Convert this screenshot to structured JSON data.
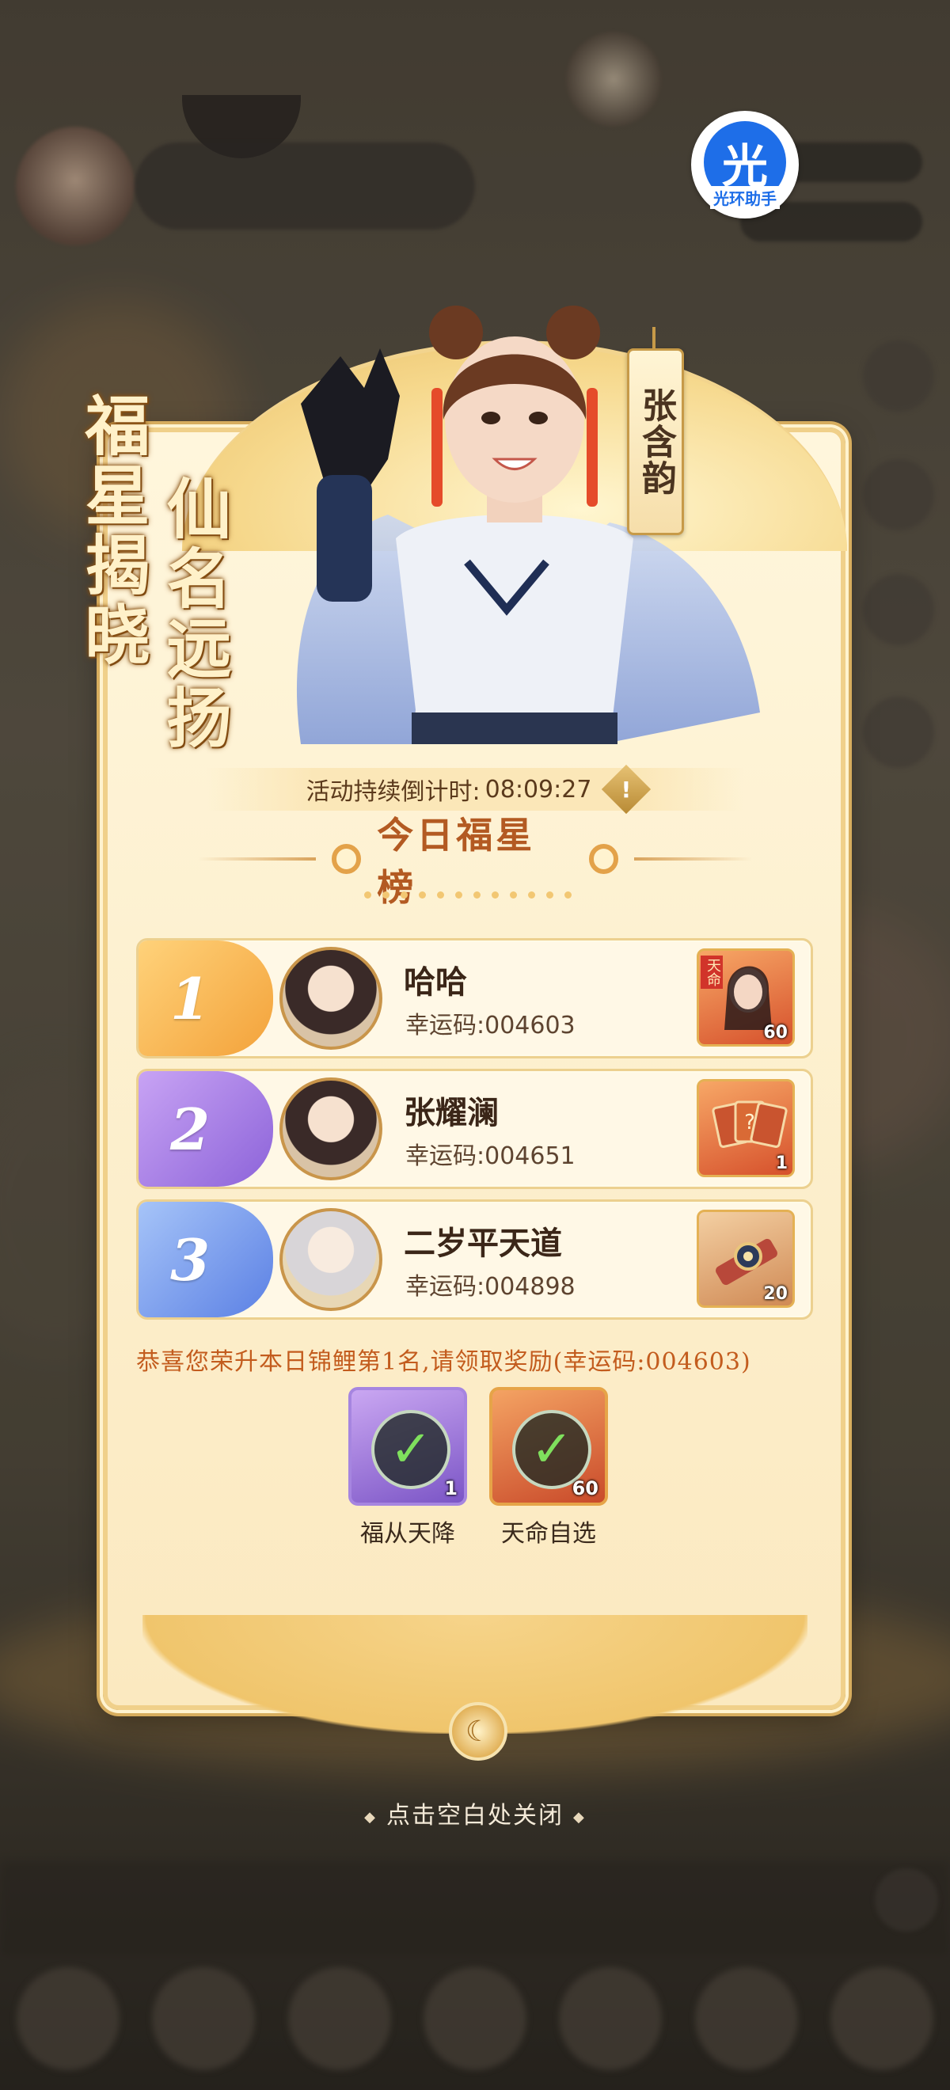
{
  "watermark": {
    "char": "光",
    "text": "光环助手"
  },
  "slogan": {
    "line1": "福星揭晓",
    "line2": "仙名远扬"
  },
  "character_name": "张含韵",
  "countdown": {
    "label": "活动持续倒计时:",
    "value": "08:09:27",
    "icon": "alert-diamond-icon"
  },
  "title": "今日福星榜",
  "rankings": [
    {
      "rank": "1",
      "name": "哈哈",
      "code_label": "幸运码:",
      "code": "004603",
      "reward_tag": "天命",
      "reward_count": "60",
      "color": "#f3a23a"
    },
    {
      "rank": "2",
      "name": "张耀澜",
      "code_label": "幸运码:",
      "code": "004651",
      "reward_tag": "",
      "reward_count": "1",
      "color": "#8c63d9"
    },
    {
      "rank": "3",
      "name": "二岁平天道",
      "code_label": "幸运码:",
      "code": "004898",
      "reward_tag": "",
      "reward_count": "20",
      "color": "#5b80e4"
    }
  ],
  "congrats": "恭喜您荣升本日锦鲤第1名,请领取奖励(幸运码:004603)",
  "claimed": [
    {
      "label": "福从天降",
      "count": "1",
      "icon": "check-icon"
    },
    {
      "label": "天命自选",
      "count": "60",
      "icon": "check-icon"
    }
  ],
  "close_hint": "点击空白处关闭"
}
